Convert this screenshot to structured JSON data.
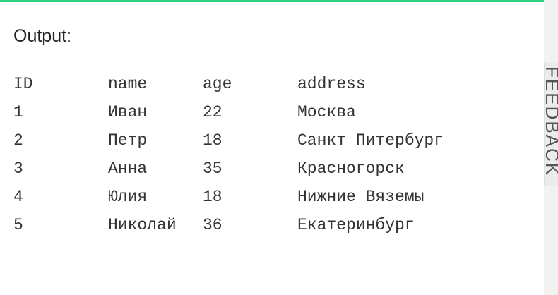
{
  "output_label": "Output:",
  "table": {
    "headers": [
      "ID",
      "name",
      "age",
      "address"
    ],
    "rows": [
      [
        "1",
        "Иван",
        "22",
        "Москва"
      ],
      [
        "2",
        "Петр",
        "18",
        "Санкт Питербург"
      ],
      [
        "3",
        "Анна",
        "35",
        "Красногорск"
      ],
      [
        "4",
        "Юлия",
        "18",
        "Нижние Вяземы"
      ],
      [
        "5",
        "Николай",
        "36",
        "Екатеринбург"
      ]
    ]
  },
  "feedback": {
    "label": "FEEDBACK"
  },
  "colors": {
    "accent": "#2fd082"
  }
}
